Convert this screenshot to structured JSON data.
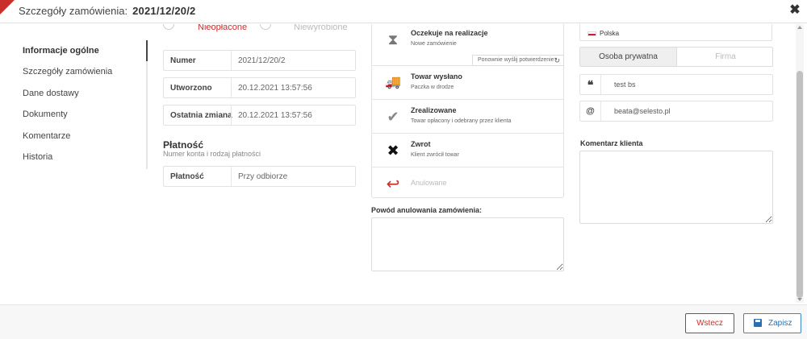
{
  "header": {
    "title_label": "Szczegóły zamówienia:",
    "order_number": "2021/12/20/2",
    "close_glyph": "✖"
  },
  "sidebar": {
    "items": [
      {
        "label": "Informacje ogólne",
        "active": true
      },
      {
        "label": "Szczegóły zamówienia",
        "active": false
      },
      {
        "label": "Dane dostawy",
        "active": false
      },
      {
        "label": "Dokumenty",
        "active": false
      },
      {
        "label": "Komentarze",
        "active": false
      },
      {
        "label": "Historia",
        "active": false
      }
    ]
  },
  "payment_status": {
    "option1": "Nieopłacone",
    "option2": "Niewyrobione",
    "option1_color": "#c9302c"
  },
  "info": {
    "number_label": "Numer",
    "number_value": "2021/12/20/2",
    "created_label": "Utworzono",
    "created_value": "20.12.2021 13:57:56",
    "modified_label": "Ostatnia zmiana",
    "modified_value": "20.12.2021 13:57:56"
  },
  "payment": {
    "title": "Płatność",
    "subtitle": "Numer konta i rodzaj płatności",
    "method_label": "Płatność",
    "method_value": "Przy odbiorze"
  },
  "statuses": [
    {
      "icon": "hourglass-icon",
      "glyph": "⧗",
      "title": "Oczekuje na realizacje",
      "subtitle": "Nowe zamówienie",
      "color": "#777"
    },
    {
      "icon": "truck-icon",
      "glyph": "🚚",
      "title": "Towar wysłano",
      "subtitle": "Paczka w drodze",
      "color": "#888"
    },
    {
      "icon": "check-icon",
      "glyph": "✔",
      "title": "Zrealizowane",
      "subtitle": "Towar opłacony i odebrany przez klienta",
      "color": "#888"
    },
    {
      "icon": "cross-icon",
      "glyph": "✖",
      "title": "Zwrot",
      "subtitle": "Klient zwrócił towar",
      "color": "#111"
    },
    {
      "icon": "undo-arrow-icon",
      "glyph": "↩",
      "title": "Anulowane",
      "subtitle": "",
      "color": "#c9302c"
    }
  ],
  "resend": {
    "label": "Ponownie wyślij potwierdzenie",
    "glyph": "↻"
  },
  "cancel_reason": {
    "label": "Powód anulowania zamówienia:",
    "value": ""
  },
  "customer": {
    "country": "Polska",
    "type_options": [
      "Osoba prywatna",
      "Firma"
    ],
    "name_icon": "❝",
    "name": "test bs",
    "email_icon": "@",
    "email": "beata@selesto.pl",
    "comment_label": "Komentarz klienta",
    "comment_value": ""
  },
  "footer": {
    "back_label": "Wstecz",
    "save_label": "Zapisz"
  },
  "colors": {
    "accent_red": "#c9302c",
    "accent_blue": "#2a6fb0"
  }
}
